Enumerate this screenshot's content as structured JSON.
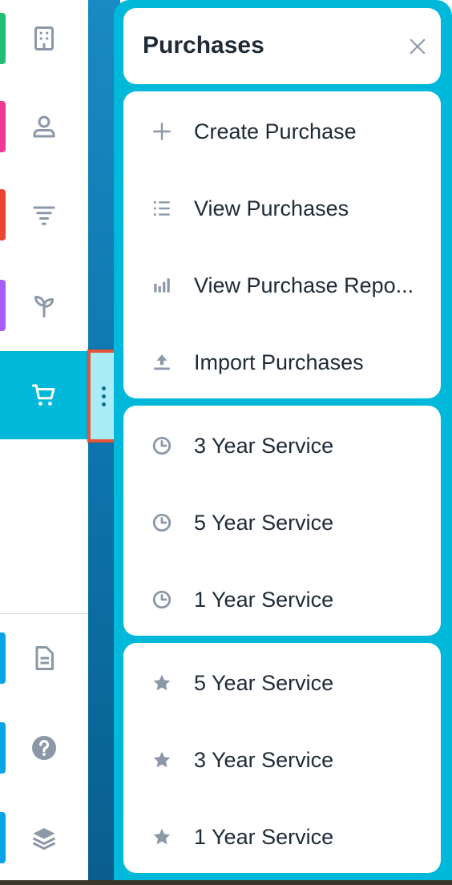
{
  "nav": {
    "items": [
      {
        "icon": "building-icon",
        "accent": "#1fbf7a"
      },
      {
        "icon": "contact-icon",
        "accent": "#ee3a96"
      },
      {
        "icon": "funnel-icon",
        "accent": "#ee4436"
      },
      {
        "icon": "sprout-icon",
        "accent": "#a45df5"
      },
      {
        "icon": "cart-icon",
        "accent": "#00b8d9",
        "active": true
      },
      {
        "icon": "document-icon",
        "accent": "#0aa3e6"
      },
      {
        "icon": "help-icon",
        "accent": "#0aa3e6"
      },
      {
        "icon": "layers-icon",
        "accent": "#0aa3e6"
      }
    ]
  },
  "panel": {
    "title": "Purchases",
    "accent": "#00b8d9",
    "actions": [
      {
        "icon": "plus-icon",
        "label": "Create Purchase"
      },
      {
        "icon": "list-icon",
        "label": "View Purchases"
      },
      {
        "icon": "bar-chart-icon",
        "label": "View Purchase Repo..."
      },
      {
        "icon": "upload-icon",
        "label": "Import Purchases"
      }
    ],
    "recent": [
      {
        "icon": "clock-icon",
        "label": "3 Year Service"
      },
      {
        "icon": "clock-icon",
        "label": "5 Year Service"
      },
      {
        "icon": "clock-icon",
        "label": "1 Year Service"
      }
    ],
    "favorites": [
      {
        "icon": "star-icon",
        "label": "5 Year Service"
      },
      {
        "icon": "star-icon",
        "label": "3 Year Service"
      },
      {
        "icon": "star-icon",
        "label": "1 Year Service"
      }
    ]
  }
}
